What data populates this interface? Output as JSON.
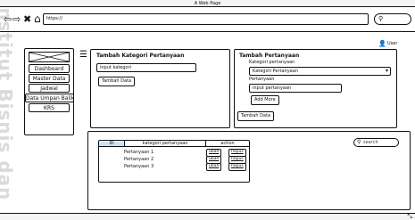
{
  "window": {
    "title": "A Web Page"
  },
  "browser": {
    "url": "https://"
  },
  "user": {
    "label": "User"
  },
  "sidebar": {
    "items": [
      "Dashboard",
      "Master Data",
      "Jadwal",
      "Data Umpan Balik",
      "KRS"
    ]
  },
  "kategori_panel": {
    "title": "Tambah Kategori Pertanyaan",
    "input_value": "input kategori",
    "button": "Tambah Data"
  },
  "pertanyaan_panel": {
    "title": "Tambah Pertanyaan",
    "kategori_label": "Kategori pertanyaan",
    "select_value": "Kategori Pertanyaan",
    "pertanyaan_label": "Pertanyaan",
    "input_value": "input pertanyaan",
    "add_more": "Add More",
    "button": "Tambah Data"
  },
  "table": {
    "headers": [
      "ID",
      "kategori pertanyaan",
      "action"
    ],
    "rows": [
      "Pertanyaan 1",
      "Pertanyaan 2",
      "Pertanyaan 3"
    ],
    "edit_label": "ubah",
    "delete_label": "hapus",
    "search_placeholder": "search"
  },
  "watermark": "Institut Bisnis dan"
}
